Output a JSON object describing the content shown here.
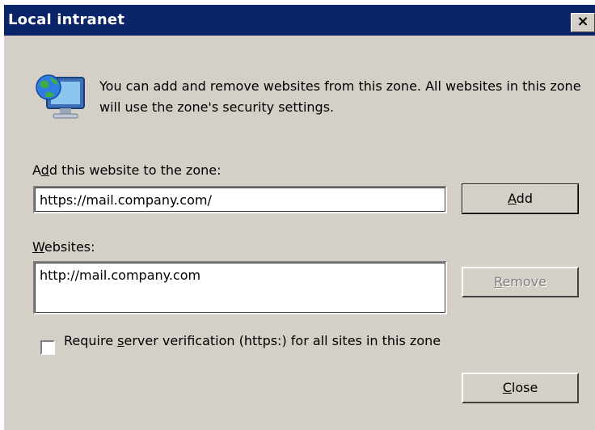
{
  "window": {
    "title": "Local intranet",
    "close_glyph": "×"
  },
  "icon": "globe-computer-icon",
  "description": "You can add and remove websites from this zone. All websites in this zone will use the zone's security settings.",
  "add_section": {
    "label_prefix": "A",
    "label_mnemonic": "d",
    "label_suffix": "d this website to the zone:",
    "input_value": "https://mail.company.com/",
    "button_mnemonic": "A",
    "button_suffix": "dd"
  },
  "websites": {
    "label_mnemonic": "W",
    "label_suffix": "ebsites:",
    "items": [
      "http://mail.company.com"
    ],
    "remove_mnemonic": "R",
    "remove_suffix": "emove"
  },
  "verification": {
    "checked": false,
    "label_prefix": "Require ",
    "label_mnemonic": "s",
    "label_suffix": "erver verification (https:) for all sites in this zone"
  },
  "close_button": {
    "mnemonic": "C",
    "suffix": "lose"
  }
}
